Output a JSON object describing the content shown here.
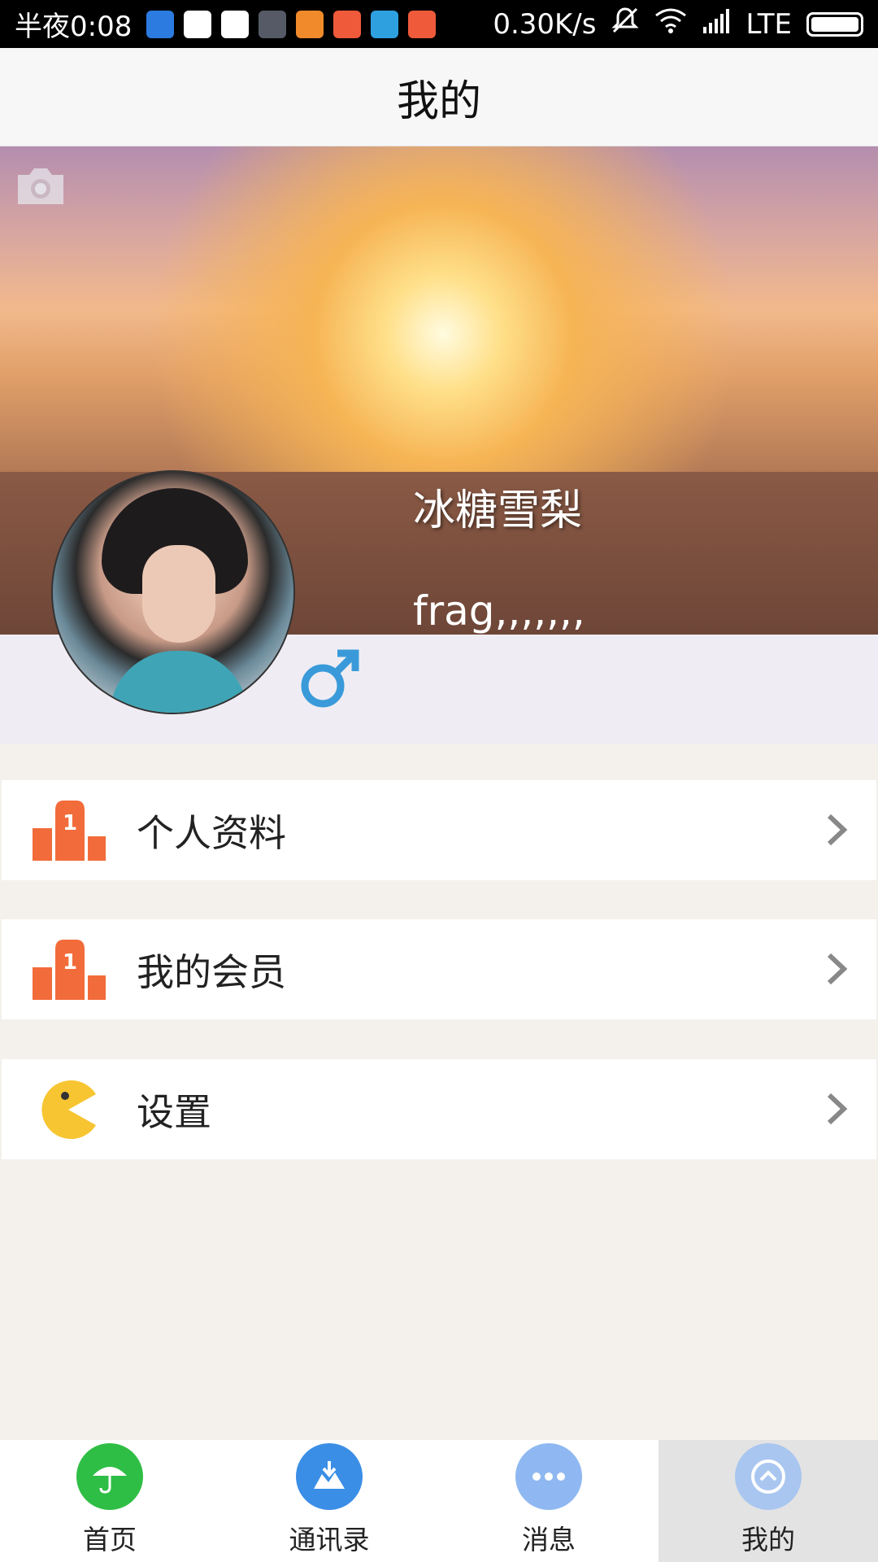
{
  "status_bar": {
    "time": "半夜0:08",
    "speed": "0.30K/s",
    "network": "LTE"
  },
  "header": {
    "title": "我的"
  },
  "profile": {
    "username": "冰糖雪梨",
    "signature": "frag,,,,,,,"
  },
  "menu": [
    {
      "label": "个人资料",
      "icon": "podium-icon"
    },
    {
      "label": "我的会员",
      "icon": "podium-icon"
    },
    {
      "label": "设置",
      "icon": "pacman-icon"
    }
  ],
  "bottom_nav": [
    {
      "label": "首页",
      "color": "#2fbe45",
      "icon": "umbrella-icon"
    },
    {
      "label": "通讯录",
      "color": "#3a8ee6",
      "icon": "download-icon"
    },
    {
      "label": "消息",
      "color": "#8fb8f2",
      "icon": "dots-icon"
    },
    {
      "label": "我的",
      "color": "#a9c6f0",
      "icon": "chevron-up-icon",
      "active": true
    }
  ],
  "colors": {
    "accent_orange": "#f26b3a",
    "gender_blue": "#3a9ad9",
    "pacman_yellow": "#f7c531"
  }
}
